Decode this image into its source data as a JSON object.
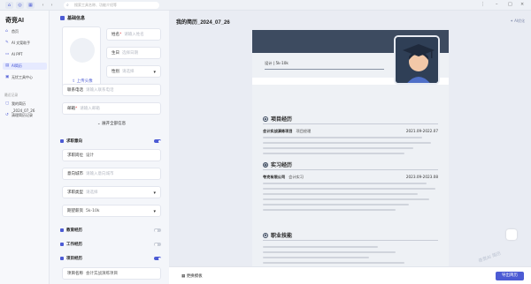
{
  "topbar": {
    "search_placeholder": "搜索工具名称、功能介绍等",
    "tab_icons": [
      "home-icon",
      "compass-icon",
      "grid-icon",
      "refresh-icon"
    ]
  },
  "nav": {
    "brand": "奇竞AI",
    "items": [
      {
        "label": "首页",
        "icon": "home-icon"
      },
      {
        "label": "AI 文案助手",
        "icon": "pen-icon"
      },
      {
        "label": "AI PPT",
        "icon": "slides-icon"
      },
      {
        "label": "AI简历",
        "icon": "resume-icon",
        "active": true
      },
      {
        "label": "无忧工具中心",
        "icon": "toolbox-icon"
      }
    ],
    "section_label": "最近记录",
    "history": [
      {
        "label": "我的简历_2024_07_26"
      },
      {
        "label": "清理简历记录"
      }
    ]
  },
  "form": {
    "basic_title": "基础信息",
    "upload_label": "上传头像",
    "name": {
      "label": "姓名",
      "placeholder": "请输入姓名"
    },
    "birthday": {
      "label": "生日",
      "placeholder": "选择日期"
    },
    "gender": {
      "label": "性别",
      "placeholder": "请选择"
    },
    "phone": {
      "label": "联系电话",
      "placeholder": "请输入联系电话"
    },
    "email": {
      "label": "邮箱",
      "placeholder": "请输入邮箱"
    },
    "expand_label": "展开全部信息",
    "intent_title": "求职意向",
    "position": {
      "label": "求职岗位",
      "value": "设计"
    },
    "city": {
      "label": "意向城市",
      "placeholder": "请输入意向城市"
    },
    "job_type": {
      "label": "求职类型",
      "placeholder": "请选择"
    },
    "salary": {
      "label": "期望薪资",
      "value": "5k-10k"
    },
    "education_title": "教育经历",
    "work_title": "工作经历",
    "project_title": "项目经历",
    "project_name": {
      "label": "项目名称",
      "value": "会计实战演练项目"
    }
  },
  "preview": {
    "title": "我的简历_2024_07_26",
    "ai_link": "AI优化",
    "header_hint": "设计 | 5k-10k",
    "sections": {
      "project": "项目经历",
      "internship": "实习经历",
      "skills": "职业技能"
    },
    "project_item": {
      "name": "会计实战演练项目",
      "role": "项目经理",
      "date": "2021.09-2022.07"
    },
    "intern_item": {
      "name": "夸克有限公司",
      "role": "会计实习",
      "date": "2023.09-2023.08"
    }
  },
  "bottombar": {
    "left_label": "更换模板",
    "export_label": "导出简历"
  },
  "watermark": "奇竞AI 简历",
  "colors": {
    "accent": "#4c5bd4",
    "resume_header": "#3d4b60",
    "resume_body": "#eef1f5"
  }
}
